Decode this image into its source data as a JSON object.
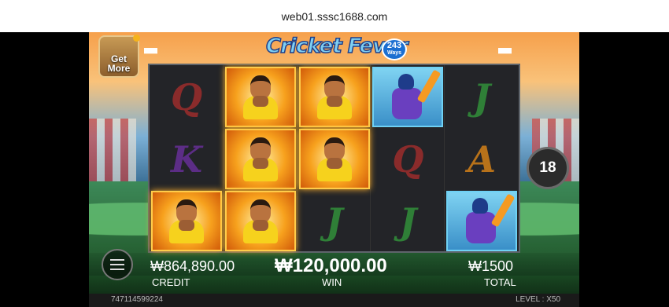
{
  "browser": {
    "url": "web01.sssc1688.com"
  },
  "game": {
    "title": "Cricket Fever",
    "ways_number": "243",
    "ways_label": "Ways",
    "get_more": "Get More"
  },
  "reels": [
    [
      "Q",
      "K",
      "captain"
    ],
    [
      "captain",
      "captain",
      "captain"
    ],
    [
      "captain",
      "captain",
      "J"
    ],
    [
      "batter",
      "Q",
      "J"
    ],
    [
      "J",
      "A",
      "batter"
    ]
  ],
  "controls": {
    "spins_left": "18"
  },
  "stats": {
    "credit_value": "₩864,890.00",
    "credit_label": "CREDIT",
    "win_value": "₩120,000.00",
    "win_label": "WIN",
    "total_value": "₩1500",
    "total_label": "TOTAL"
  },
  "footer": {
    "account_id": "747114599224",
    "level": "LEVEL : X50"
  },
  "colors": {
    "captain_frame": "#ffcc4a",
    "batter_frame": "#6fd1f4",
    "reel_bg": "#232428"
  }
}
